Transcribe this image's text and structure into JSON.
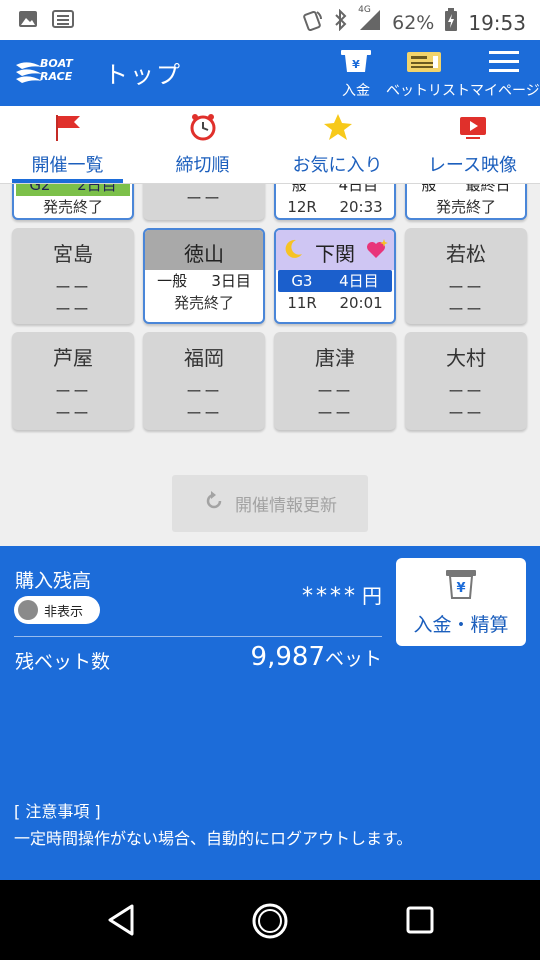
{
  "status_bar": {
    "battery": "62%",
    "network": "4G",
    "time": "19:53"
  },
  "header": {
    "logo_line1": "BOAT",
    "logo_line2": "RACE",
    "title": "トップ",
    "buttons": [
      {
        "label": "入金",
        "icon": "yen-ticket-icon"
      },
      {
        "label": "ベットリスト",
        "icon": "bet-ticket-icon"
      },
      {
        "label": "マイページ",
        "icon": "hamburger-menu-icon"
      }
    ]
  },
  "tabs": [
    {
      "label": "開催一覧",
      "icon": "red-flag-icon",
      "active": true
    },
    {
      "label": "締切順",
      "icon": "alarm-clock-icon",
      "active": false
    },
    {
      "label": "お気に入り",
      "icon": "star-icon",
      "active": false
    },
    {
      "label": "レース映像",
      "icon": "video-play-icon",
      "active": false
    }
  ],
  "venues_top_partial": [
    {
      "grade_left": "G2",
      "grade_right": "2日目",
      "foot_left": "発売終了",
      "foot_right": ""
    },
    {
      "grade_left": "",
      "grade_right": "",
      "foot_left": "ーー",
      "foot_right": ""
    },
    {
      "grade_left": "般",
      "grade_right": "4日目",
      "foot_left": "12R",
      "foot_right": "20:33"
    },
    {
      "grade_left": "般",
      "grade_right": "最終日",
      "foot_left": "発売終了",
      "foot_right": ""
    }
  ],
  "venues": [
    {
      "name": "宮島",
      "line1": "ーー",
      "line2": "ーー"
    },
    {
      "name": "徳山",
      "grade": "一般",
      "day": "3日目",
      "status": "発売終了"
    },
    {
      "name": "下関",
      "grade": "G3",
      "day": "4日目",
      "race": "11R",
      "time": "20:01"
    },
    {
      "name": "若松",
      "line1": "ーー",
      "line2": "ーー"
    },
    {
      "name": "芦屋",
      "line1": "ーー",
      "line2": "ーー"
    },
    {
      "name": "福岡",
      "line1": "ーー",
      "line2": "ーー"
    },
    {
      "name": "唐津",
      "line1": "ーー",
      "line2": "ーー"
    },
    {
      "name": "大村",
      "line1": "ーー",
      "line2": "ーー"
    }
  ],
  "refresh_label": "開催情報更新",
  "balance": {
    "label": "購入残高",
    "toggle_label": "非表示",
    "value_masked": "****",
    "unit": "円"
  },
  "bets": {
    "label": "残ベット数",
    "value": "9,987",
    "unit": "ベット"
  },
  "deposit_button": "入金・精算",
  "notice": {
    "heading": "[ 注意事項 ]",
    "body": "一定時間操作がない場合、自動的にログアウトします。"
  },
  "colors": {
    "brand_blue": "#1c6cd9",
    "grade_g3": "#1b5fcc",
    "grade_g2": "#7cc04a",
    "night_purple": "#cfc6f3",
    "flag_red": "#e0302b"
  }
}
